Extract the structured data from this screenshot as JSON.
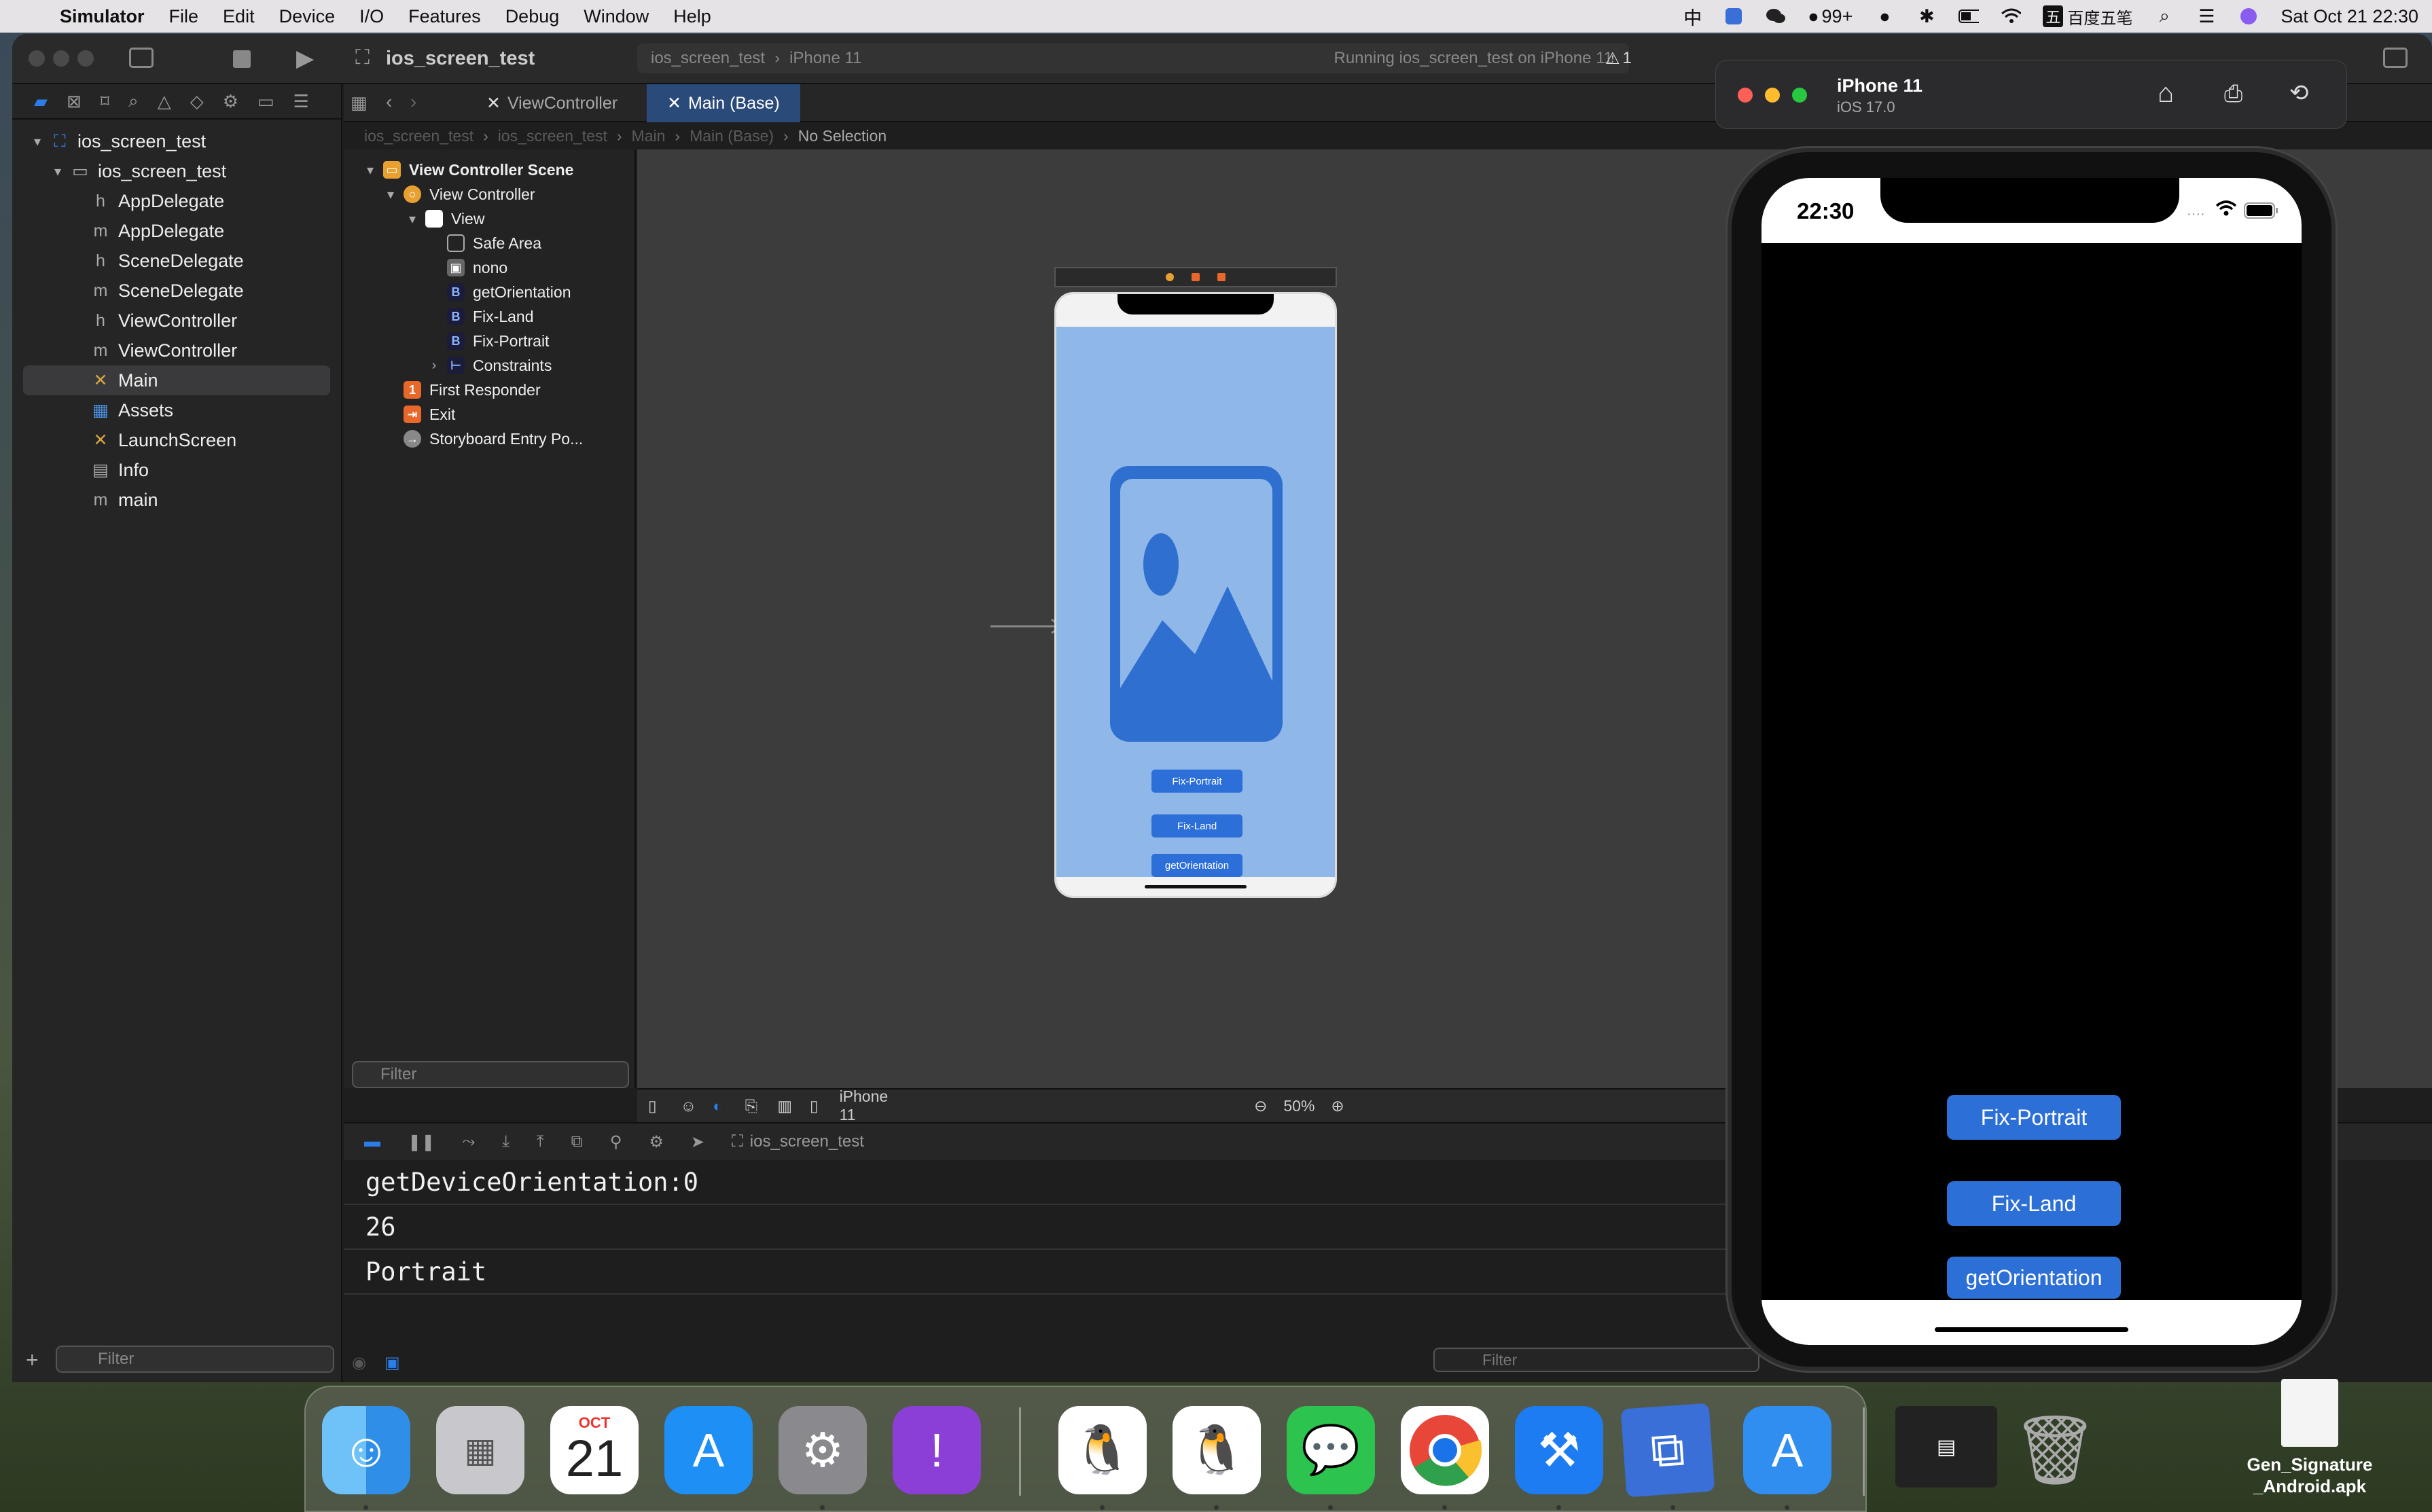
{
  "menubar": {
    "app_name": "Simulator",
    "items": [
      "File",
      "Edit",
      "Device",
      "I/O",
      "Features",
      "Debug",
      "Window",
      "Help"
    ],
    "input_method": "中",
    "qq_badge": "99+",
    "ime_label": "百度五笔",
    "datetime": "Sat Oct 21  22:30"
  },
  "toolbar": {
    "project": "ios_screen_test",
    "scheme": "ios_screen_test",
    "destination": "iPhone 11",
    "status": "Running ios_screen_test on iPhone 11",
    "warning_count": "1"
  },
  "navigator": {
    "root": "ios_screen_test",
    "group": "ios_screen_test",
    "files": [
      {
        "icon": "h",
        "name": "AppDelegate"
      },
      {
        "icon": "m",
        "name": "AppDelegate"
      },
      {
        "icon": "h",
        "name": "SceneDelegate"
      },
      {
        "icon": "m",
        "name": "SceneDelegate"
      },
      {
        "icon": "h",
        "name": "ViewController"
      },
      {
        "icon": "m",
        "name": "ViewController"
      },
      {
        "icon": "✕",
        "name": "Main"
      },
      {
        "icon": "▦",
        "name": "Assets"
      },
      {
        "icon": "✕",
        "name": "LaunchScreen"
      },
      {
        "icon": "▤",
        "name": "Info"
      },
      {
        "icon": "m",
        "name": "main"
      }
    ],
    "filter_placeholder": "Filter"
  },
  "tabs": [
    "ViewController",
    "Main (Base)"
  ],
  "jumpbar": [
    "ios_screen_test",
    "ios_screen_test",
    "Main",
    "Main (Base)",
    "No Selection"
  ],
  "outline": {
    "scene": "View Controller Scene",
    "view_controller": "View Controller",
    "view": "View",
    "children": [
      "Safe Area",
      "nono",
      "getOrientation",
      "Fix-Land",
      "Fix-Portrait",
      "Constraints"
    ],
    "first_responder": "First Responder",
    "exit": "Exit",
    "entry": "Storyboard Entry Po...",
    "filter_placeholder": "Filter"
  },
  "storyboard": {
    "buttons": [
      "Fix-Portrait",
      "Fix-Land",
      "getOrientation"
    ]
  },
  "canvasbar": {
    "device": "iPhone 11",
    "zoom": "50%"
  },
  "debugbar": {
    "target": "ios_screen_test"
  },
  "console": {
    "lines": [
      "getDeviceOrientation:0",
      "26",
      "Portrait"
    ],
    "filter_placeholder": "Filter"
  },
  "simulator": {
    "device_name": "iPhone 11",
    "os": "iOS 17.0",
    "time": "22:30",
    "buttons": [
      "Fix-Portrait",
      "Fix-Land",
      "getOrientation"
    ]
  },
  "dock": {
    "calendar_month": "OCT",
    "calendar_day": "21",
    "apps": [
      "finder",
      "launchpad",
      "calendar",
      "app-store",
      "system-settings",
      "feedback",
      "qq",
      "qq",
      "wechat",
      "chrome",
      "xcode",
      "instruments",
      "simulator",
      "screenshot",
      "trash"
    ]
  },
  "desktop": {
    "file_name": "Gen_Signature_Android.apk"
  },
  "colors": {
    "accent": "#2c6fd7",
    "selected": "#2b7de9"
  }
}
